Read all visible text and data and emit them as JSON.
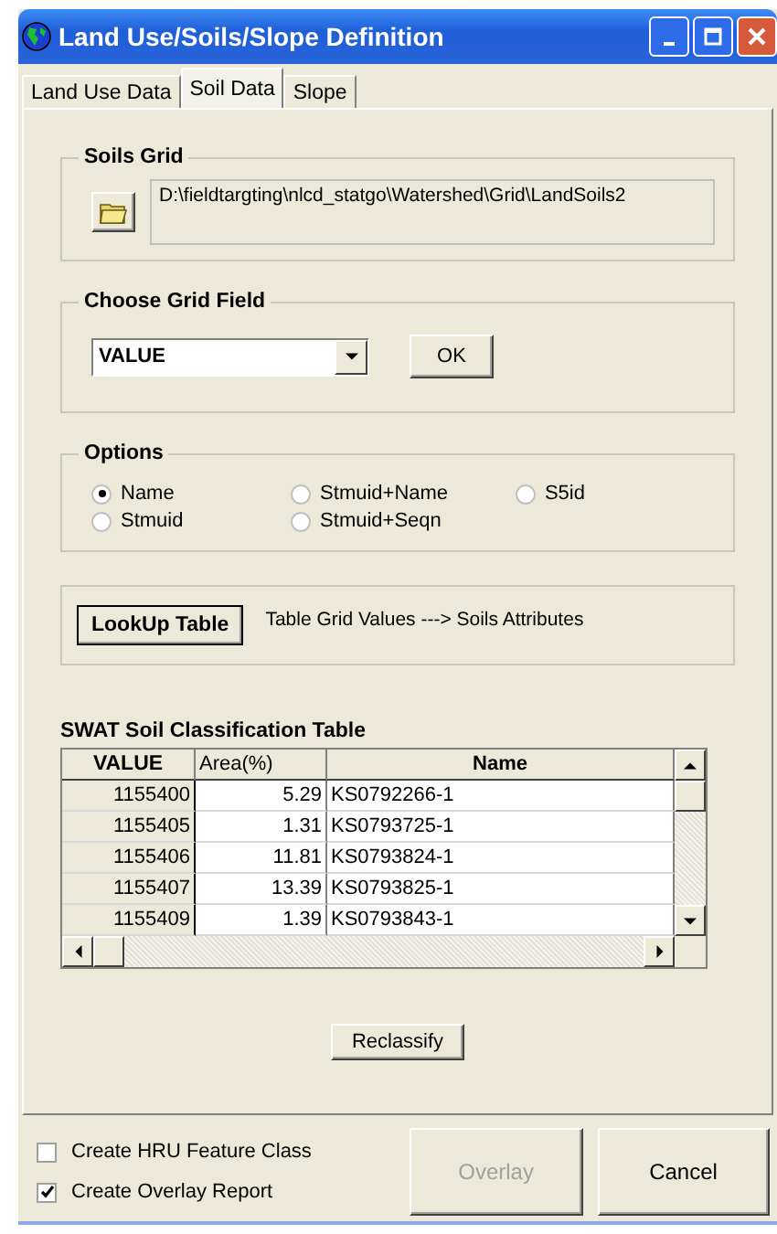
{
  "window": {
    "title": "Land Use/Soils/Slope Definition"
  },
  "tabs": [
    {
      "label": "Land Use Data",
      "selected": false
    },
    {
      "label": "Soil Data",
      "selected": true
    },
    {
      "label": "Slope",
      "selected": false
    }
  ],
  "soils_grid": {
    "title": "Soils Grid",
    "path": "D:\\fieldtargting\\nlcd_statgo\\Watershed\\Grid\\LandSoils2"
  },
  "grid_field": {
    "title": "Choose Grid Field",
    "value": "VALUE",
    "ok_button": "OK"
  },
  "options": {
    "title": "Options",
    "items": [
      {
        "label": "Name",
        "selected": true
      },
      {
        "label": "Stmuid",
        "selected": false
      },
      {
        "label": "Stmuid+Name",
        "selected": false
      },
      {
        "label": "Stmuid+Seqn",
        "selected": false
      },
      {
        "label": "S5id",
        "selected": false
      }
    ]
  },
  "lookup": {
    "button": "LookUp Table",
    "description": "Table Grid Values ---> Soils Attributes"
  },
  "table": {
    "title": "SWAT Soil Classification Table",
    "columns": [
      "VALUE",
      "Area(%)",
      "Name"
    ],
    "rows": [
      [
        "1155400",
        "5.29",
        "KS0792266-1"
      ],
      [
        "1155405",
        "1.31",
        "KS0793725-1"
      ],
      [
        "1155406",
        "11.81",
        "KS0793824-1"
      ],
      [
        "1155407",
        "13.39",
        "KS0793825-1"
      ],
      [
        "1155409",
        "1.39",
        "KS0793843-1"
      ]
    ]
  },
  "reclassify_button": "Reclassify",
  "checkboxes": [
    {
      "label": "Create HRU Feature Class",
      "checked": false
    },
    {
      "label": "Create Overlay Report",
      "checked": true
    }
  ],
  "buttons": [
    {
      "label": "Overlay",
      "disabled": true
    },
    {
      "label": "Cancel",
      "disabled": false
    }
  ]
}
